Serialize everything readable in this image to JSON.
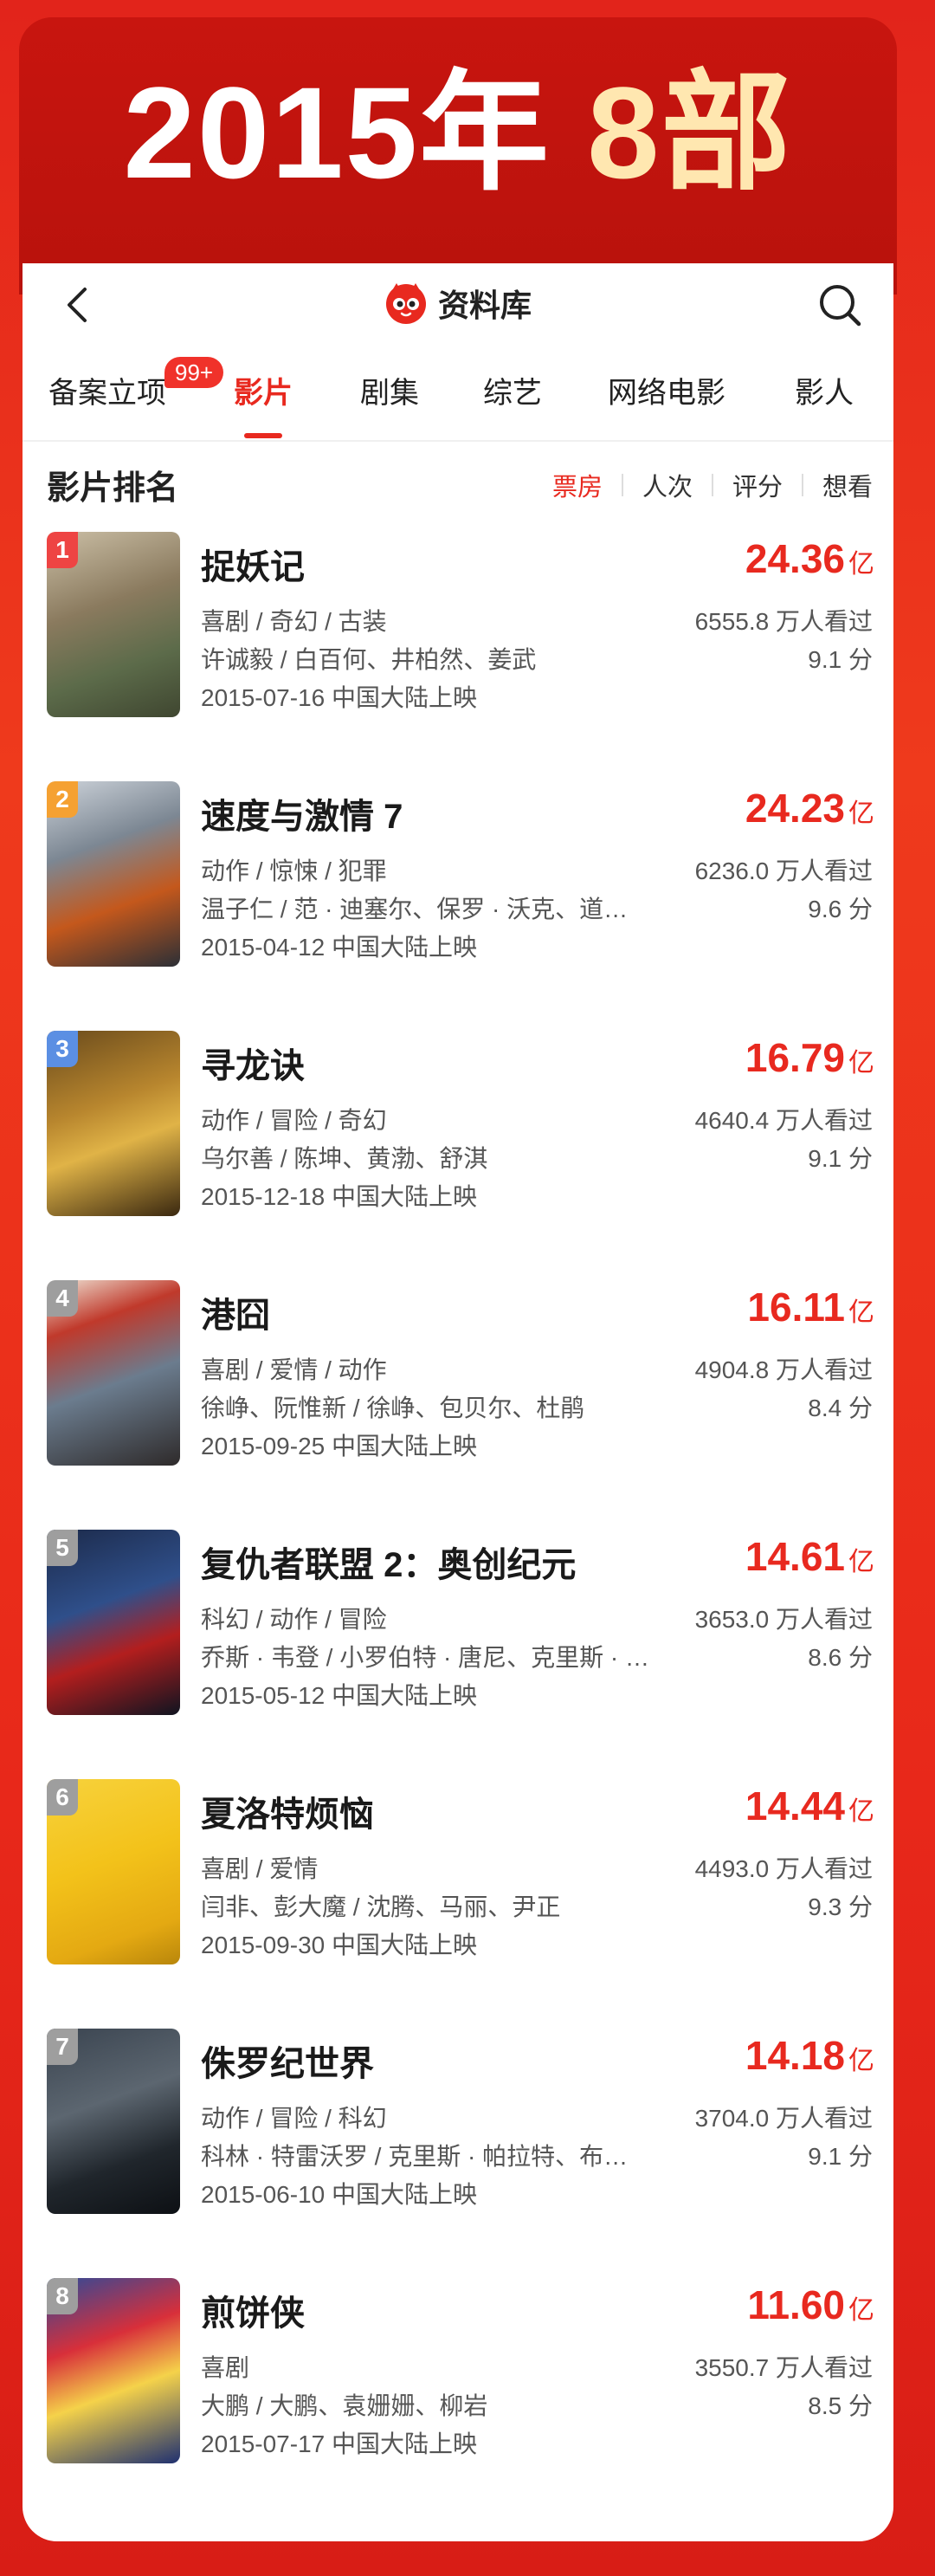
{
  "banner": {
    "year_label": "2015年",
    "count_label": "8部"
  },
  "topbar": {
    "brand": "资料库"
  },
  "tabs": [
    {
      "label": "备案立项",
      "badge": "99+"
    },
    {
      "label": "影片"
    },
    {
      "label": "剧集"
    },
    {
      "label": "综艺"
    },
    {
      "label": "网络电影"
    },
    {
      "label": "影人"
    }
  ],
  "section": {
    "title": "影片排名"
  },
  "sort": [
    "票房",
    "人次",
    "评分",
    "想看"
  ],
  "colors": {
    "accent": "#e8291f",
    "rank1": "#ee4443",
    "rank2": "#f5a132",
    "rank3": "#5b8fe3",
    "rank_other": "#9e9e9e"
  },
  "unit": "亿",
  "movies": [
    {
      "rank": "1",
      "title": "捉妖记",
      "box": "24.36",
      "genres": "喜剧 / 奇幻 / 古装",
      "people": "许诚毅 / 白百何、井柏然、姜武",
      "release": "2015-07-16 中国大陆上映",
      "audience": "6555.8 万人看过",
      "score": "9.1 分"
    },
    {
      "rank": "2",
      "title": "速度与激情 7",
      "box": "24.23",
      "genres": "动作 / 惊悚 / 犯罪",
      "people": "温子仁 / 范 · 迪塞尔、保罗 · 沃克、道…",
      "release": "2015-04-12 中国大陆上映",
      "audience": "6236.0 万人看过",
      "score": "9.6 分"
    },
    {
      "rank": "3",
      "title": "寻龙诀",
      "box": "16.79",
      "genres": "动作 / 冒险 / 奇幻",
      "people": "乌尔善 / 陈坤、黄渤、舒淇",
      "release": "2015-12-18 中国大陆上映",
      "audience": "4640.4 万人看过",
      "score": "9.1 分"
    },
    {
      "rank": "4",
      "title": "港囧",
      "box": "16.11",
      "genres": "喜剧 / 爱情 / 动作",
      "people": "徐峥、阮惟新 / 徐峥、包贝尔、杜鹃",
      "release": "2015-09-25 中国大陆上映",
      "audience": "4904.8 万人看过",
      "score": "8.4 分"
    },
    {
      "rank": "5",
      "title": "复仇者联盟 2：奥创纪元",
      "box": "14.61",
      "genres": "科幻 / 动作 / 冒险",
      "people": "乔斯 · 韦登 / 小罗伯特 · 唐尼、克里斯 · …",
      "release": "2015-05-12 中国大陆上映",
      "audience": "3653.0 万人看过",
      "score": "8.6 分"
    },
    {
      "rank": "6",
      "title": "夏洛特烦恼",
      "box": "14.44",
      "genres": "喜剧 / 爱情",
      "people": "闫非、彭大魔 / 沈腾、马丽、尹正",
      "release": "2015-09-30 中国大陆上映",
      "audience": "4493.0 万人看过",
      "score": "9.3 分"
    },
    {
      "rank": "7",
      "title": "侏罗纪世界",
      "box": "14.18",
      "genres": "动作 / 冒险 / 科幻",
      "people": "科林 · 特雷沃罗 / 克里斯 · 帕拉特、布…",
      "release": "2015-06-10 中国大陆上映",
      "audience": "3704.0 万人看过",
      "score": "9.1 分"
    },
    {
      "rank": "8",
      "title": "煎饼侠",
      "box": "11.60",
      "genres": "喜剧",
      "people": "大鹏 / 大鹏、袁姗姗、柳岩",
      "release": "2015-07-17 中国大陆上映",
      "audience": "3550.7 万人看过",
      "score": "8.5 分"
    }
  ]
}
